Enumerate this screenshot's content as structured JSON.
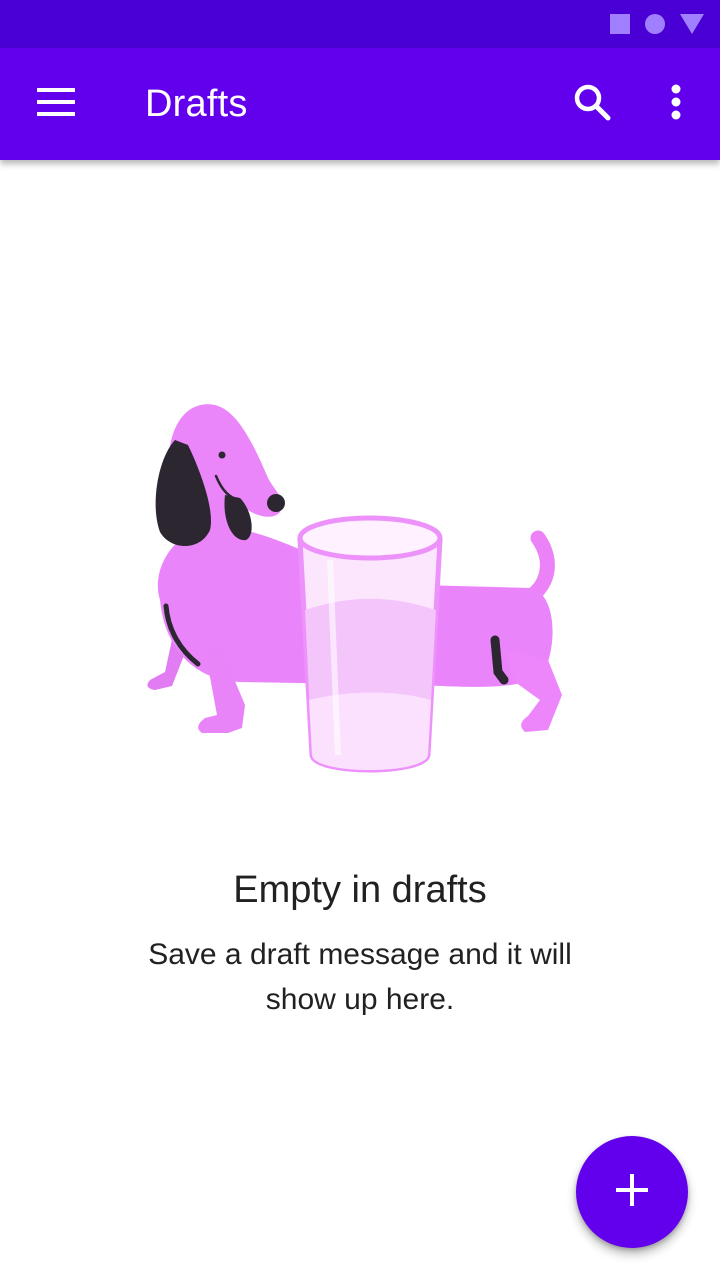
{
  "status_bar": {
    "icons": [
      "square-icon",
      "circle-icon",
      "triangle-icon"
    ],
    "icon_color": "#a080ff"
  },
  "app_bar": {
    "title": "Drafts",
    "background": "#6200ee",
    "icons": [
      "menu-icon",
      "search-icon",
      "more-vert-icon"
    ]
  },
  "empty_state": {
    "illustration": "dachshund-with-glass-illustration",
    "title": "Empty in drafts",
    "message": "Save a draft message and it will show up here."
  },
  "fab": {
    "icon": "add-icon",
    "color": "#6200ee"
  }
}
